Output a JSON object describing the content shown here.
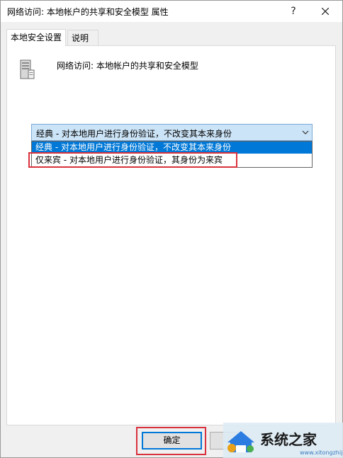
{
  "window": {
    "title": "网络访问: 本地帐户的共享和安全模型 属性",
    "help_glyph": "?",
    "close_icon": "close-icon"
  },
  "tabs": [
    {
      "label": "本地安全设置",
      "active": true
    },
    {
      "label": "说明",
      "active": false
    }
  ],
  "policy": {
    "icon": "policy-server-icon",
    "name": "网络访问: 本地帐户的共享和安全模型"
  },
  "select": {
    "value": "经典 - 对本地用户进行身份验证，不改变其本来身份",
    "options": [
      {
        "label": "经典 - 对本地用户进行身份验证，不改变其本来身份",
        "highlighted": true
      },
      {
        "label": "仅来宾 - 对本地用户进行身份验证，其身份为来宾",
        "highlighted": false
      }
    ]
  },
  "buttons": {
    "ok_label": "确定",
    "cancel_label": ""
  },
  "watermark": {
    "text": "系统之家",
    "url": "www.xitongzhijia.net"
  },
  "colors": {
    "selection": "#0078d7",
    "select_bg": "#cce4f7",
    "annotation": "#d9313d"
  }
}
